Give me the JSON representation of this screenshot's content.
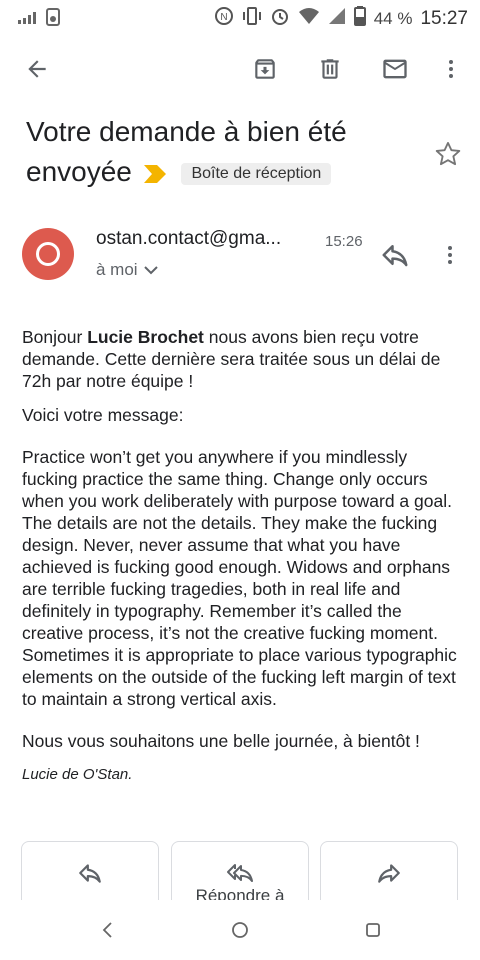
{
  "status_bar": {
    "battery_percent": "44 %",
    "clock": "15:27"
  },
  "email": {
    "subject": "Votre demande à bien été envoyée",
    "label": "Boîte de réception",
    "sender": "ostan.contact@gma...",
    "time": "15:26",
    "recipient": "à moi",
    "avatar_color": "#dd5a4e"
  },
  "body": {
    "greeting": "Bonjour ",
    "name": "Lucie Brochet",
    "intro_rest": " nous avons bien reçu votre demande. Cette dernière sera traitée sous un délai de 72h par notre équipe !",
    "message_label": "Voici votre message:",
    "message": "Practice won’t get you anywhere if you mindlessly fucking practice the same thing. Change only occurs when you work deliberately with purpose toward a goal. The details are not the details. They make the fucking design. Never, never assume that what you have achieved is fucking good enough. Widows and orphans are terrible fucking tragedies, both in real life and definitely in typography. Remember it’s called the creative process, it’s not the creative fucking moment. Sometimes it is appropriate to place various typographic elements on the outside of the fucking left margin of text to maintain a strong vertical axis.",
    "closing": "Nous vous souhaitons une belle journée, à bientôt !",
    "signature": "Lucie de O'Stan."
  },
  "actions": {
    "reply_all_label": "Répondre à"
  },
  "icons": {
    "back": "arrow-left-icon",
    "archive": "archive-icon",
    "delete": "trash-icon",
    "mark_unread": "mail-icon",
    "more": "more-vert-icon"
  },
  "colors": {
    "label_arrow": "#f4b400"
  }
}
